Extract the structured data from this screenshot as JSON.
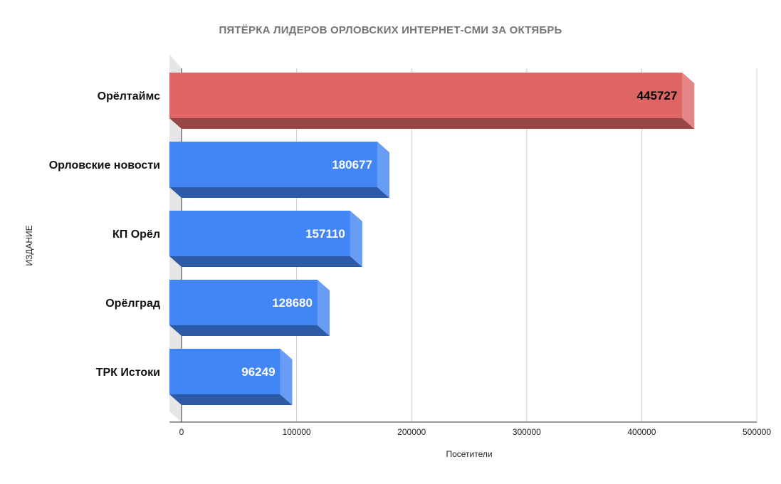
{
  "chart_data": {
    "type": "bar",
    "orientation": "horizontal",
    "style": "3d",
    "title": "ПЯТЁРКА ЛИДЕРОВ ОРЛОВСКИХ ИНТЕРНЕТ-СМИ ЗА ОКТЯБРЬ",
    "xlabel": "Посетители",
    "ylabel": "ИЗДАНИЕ",
    "xlim": [
      0,
      500000
    ],
    "x_ticks": [
      0,
      100000,
      200000,
      300000,
      400000,
      500000
    ],
    "grid": true,
    "legend": "none",
    "categories": [
      "Орёлтаймс",
      "Орловские новости",
      "КП Орёл",
      "Орёлград",
      "ТРК Истоки"
    ],
    "values": [
      445727,
      180677,
      157110,
      128680,
      96249
    ],
    "data_labels": [
      "445727",
      "180677",
      "157110",
      "128680",
      "96249"
    ],
    "bar_colors": [
      "#e06666",
      "#4285f4",
      "#4285f4",
      "#4285f4",
      "#4285f4"
    ]
  }
}
